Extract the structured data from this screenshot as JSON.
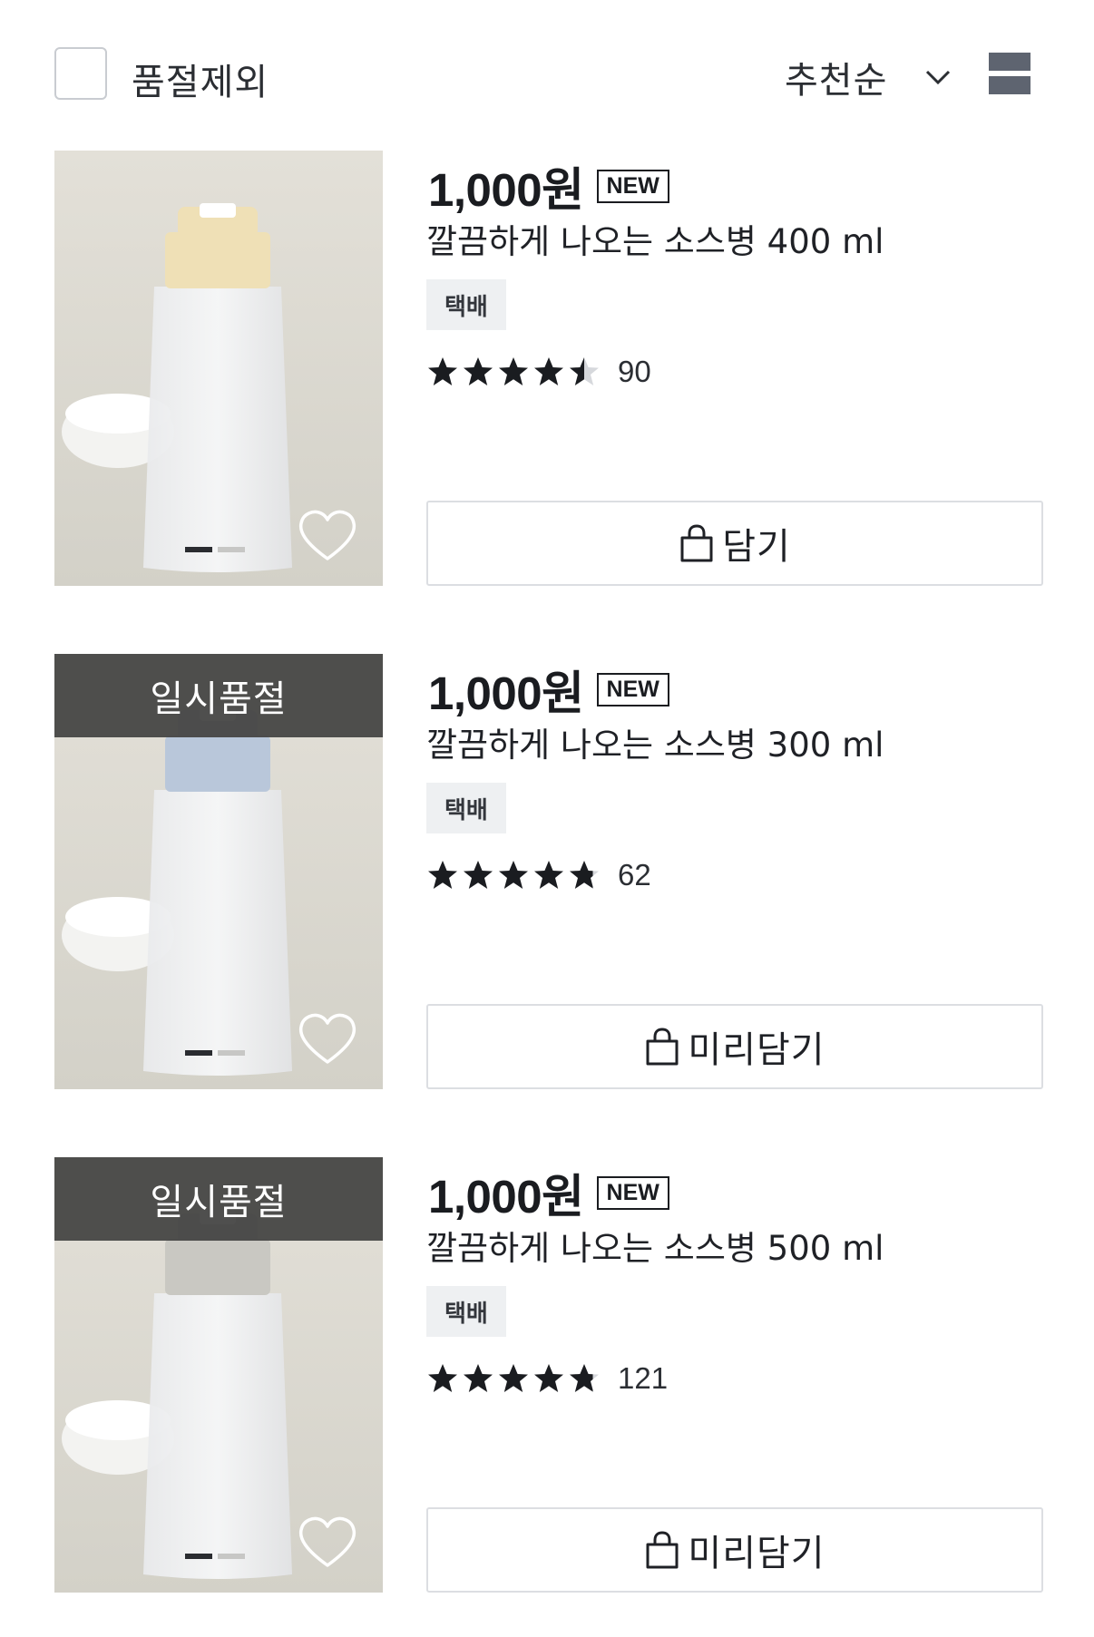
{
  "filter": {
    "exclude_soldout_label": "품절제외",
    "sort_label": "추천순"
  },
  "products": [
    {
      "price": "1,000원",
      "badge": "NEW",
      "name": "깔끔하게 나오는 소스병 400 ml",
      "shipping": "택배",
      "rating": 4.5,
      "review_count": "90",
      "sold_out": false,
      "soldout_label": "",
      "cart_label": "담기",
      "cap_color": "#efe0b6"
    },
    {
      "price": "1,000원",
      "badge": "NEW",
      "name": "깔끔하게 나오는 소스병 300 ml",
      "shipping": "택배",
      "rating": 4.8,
      "review_count": "62",
      "sold_out": true,
      "soldout_label": "일시품절",
      "cart_label": "미리담기",
      "cap_color": "#b9c7da"
    },
    {
      "price": "1,000원",
      "badge": "NEW",
      "name": "깔끔하게 나오는 소스병 500 ml",
      "shipping": "택배",
      "rating": 4.8,
      "review_count": "121",
      "sold_out": true,
      "soldout_label": "일시품절",
      "cart_label": "미리담기",
      "cap_color": "#c9c8c2"
    }
  ],
  "icons": {
    "chevron": "chevron-down-icon",
    "view": "list-view-icon",
    "heart": "heart-icon",
    "bag": "shopping-bag-icon",
    "star": "star-icon"
  }
}
